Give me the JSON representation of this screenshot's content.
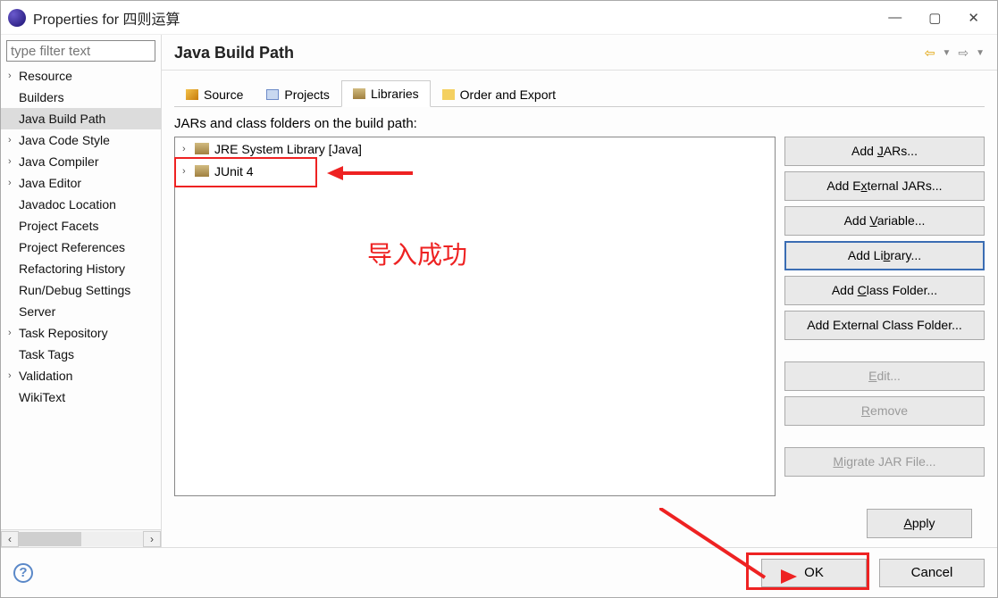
{
  "window": {
    "title": "Properties for 四则运算"
  },
  "filter": {
    "placeholder": "type filter text"
  },
  "sidebar": {
    "items": [
      {
        "label": "Resource",
        "expandable": true
      },
      {
        "label": "Builders",
        "expandable": false
      },
      {
        "label": "Java Build Path",
        "expandable": false,
        "selected": true
      },
      {
        "label": "Java Code Style",
        "expandable": true
      },
      {
        "label": "Java Compiler",
        "expandable": true
      },
      {
        "label": "Java Editor",
        "expandable": true
      },
      {
        "label": "Javadoc Location",
        "expandable": false
      },
      {
        "label": "Project Facets",
        "expandable": false
      },
      {
        "label": "Project References",
        "expandable": false
      },
      {
        "label": "Refactoring History",
        "expandable": false
      },
      {
        "label": "Run/Debug Settings",
        "expandable": false
      },
      {
        "label": "Server",
        "expandable": false
      },
      {
        "label": "Task Repository",
        "expandable": true
      },
      {
        "label": "Task Tags",
        "expandable": false
      },
      {
        "label": "Validation",
        "expandable": true
      },
      {
        "label": "WikiText",
        "expandable": false
      }
    ]
  },
  "page": {
    "title": "Java Build Path"
  },
  "tabs": {
    "source": "Source",
    "projects": "Projects",
    "libraries": "Libraries",
    "order": "Order and Export"
  },
  "jars_label": "JARs and class folders on the build path:",
  "libs": [
    {
      "label": "JRE System Library [Java]"
    },
    {
      "label": "JUnit 4"
    }
  ],
  "annotation": {
    "success": "导入成功"
  },
  "buttons": {
    "add_jars_pre": "Add ",
    "add_jars_u": "J",
    "add_jars_post": "ARs...",
    "add_ext_jars_pre": "Add E",
    "add_ext_jars_u": "x",
    "add_ext_jars_post": "ternal JARs...",
    "add_var_pre": "Add ",
    "add_var_u": "V",
    "add_var_post": "ariable...",
    "add_lib_pre": "Add Li",
    "add_lib_u": "b",
    "add_lib_post": "rary...",
    "add_cls_pre": "Add ",
    "add_cls_u": "C",
    "add_cls_post": "lass Folder...",
    "add_ext_cls": "Add External Class Folder...",
    "edit_u": "E",
    "edit_post": "dit...",
    "remove_u": "R",
    "remove_post": "emove",
    "migrate_u": "M",
    "migrate_post": "igrate JAR File...",
    "apply_u": "A",
    "apply_post": "pply",
    "ok": "OK",
    "cancel": "Cancel"
  }
}
